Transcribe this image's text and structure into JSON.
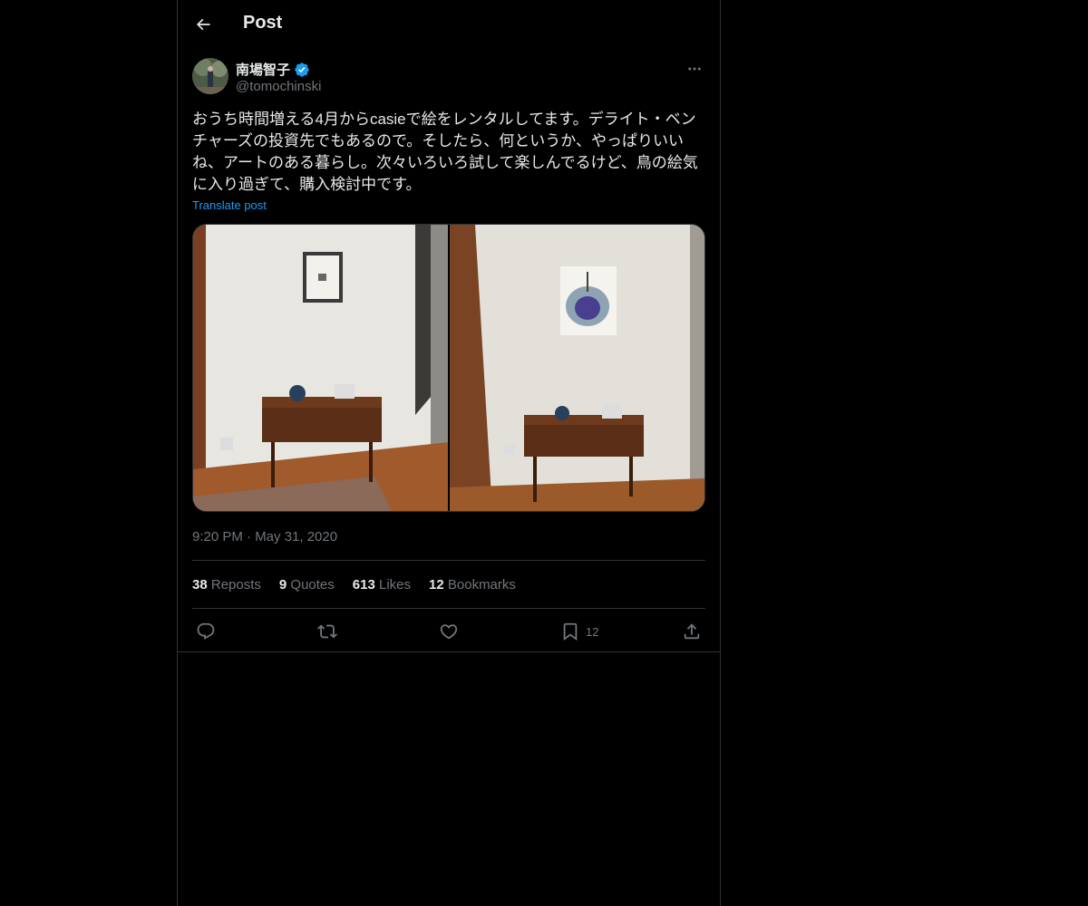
{
  "header": {
    "title": "Post",
    "back_icon": "arrow-left-icon"
  },
  "post": {
    "author_name": "南場智子",
    "author_handle": "@tomochinski",
    "verified": true,
    "text": "おうち時間増える4月からcasieで絵をレンタルしてます。デライト・ベンチャーズの投資先でもあるので。そしたら、何というか、やっぱりいいね、アートのある暮らし。次々いろいろ試して楽しんでるけど、鳥の絵気に入り過ぎて、購入検討中です。",
    "translate_label": "Translate post",
    "timestamp": "9:20 PM · May 31, 2020"
  },
  "stats": [
    {
      "count": "38",
      "label": "Reposts"
    },
    {
      "count": "9",
      "label": "Quotes"
    },
    {
      "count": "613",
      "label": "Likes"
    },
    {
      "count": "12",
      "label": "Bookmarks"
    }
  ],
  "actions": {
    "reply_icon": "reply-icon",
    "repost_icon": "repost-icon",
    "like_icon": "heart-icon",
    "bookmark_icon": "bookmark-icon",
    "bookmark_count": "12",
    "share_icon": "share-icon"
  },
  "colors": {
    "background": "#000000",
    "text": "#e7e9ea",
    "muted": "#71767b",
    "accent": "#1d9bf0",
    "border": "#2f3336"
  }
}
